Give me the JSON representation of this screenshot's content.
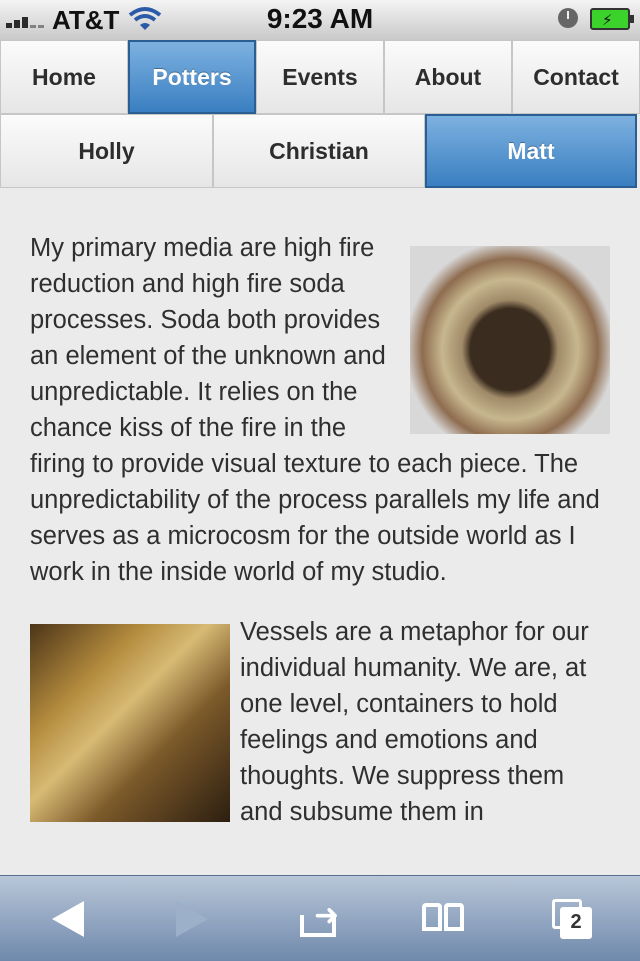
{
  "status": {
    "carrier": "AT&T",
    "time": "9:23 AM",
    "signal_icon": "signal-bars-icon",
    "wifi_icon": "wifi-icon",
    "clock_icon": "clock-icon",
    "battery_icon": "battery-charging-icon"
  },
  "nav_primary": [
    {
      "label": "Home",
      "active": false
    },
    {
      "label": "Potters",
      "active": true
    },
    {
      "label": "Events",
      "active": false
    },
    {
      "label": "About",
      "active": false
    },
    {
      "label": "Contact",
      "active": false
    }
  ],
  "nav_secondary": [
    {
      "label": "Holly",
      "active": false
    },
    {
      "label": "Christian",
      "active": false
    },
    {
      "label": "Matt",
      "active": true
    }
  ],
  "content": {
    "paragraph1": "My primary media are high fire reduction and high fire soda processes. Soda both provides an element of the unknown and unpredictable. It relies on the chance kiss of the fire in the firing to provide visual texture to each piece. The unpredictability of the process parallels my life and serves as a microcosm for the outside world as I work in the inside world of my studio.",
    "paragraph2": "Vessels are a metaphor for our individual humanity. We are, at one level, containers to hold feelings and emotions and thoughts. We suppress them and subsume them in"
  },
  "toolbar": {
    "back_icon": "back-arrow-icon",
    "forward_icon": "forward-arrow-icon",
    "share_icon": "share-icon",
    "bookmarks_icon": "bookmarks-icon",
    "pages_icon": "pages-icon",
    "pages_count": "2"
  },
  "colors": {
    "active_tab": "#3a7fc1",
    "toolbar": "#6f89ac",
    "background": "#ebebeb"
  }
}
